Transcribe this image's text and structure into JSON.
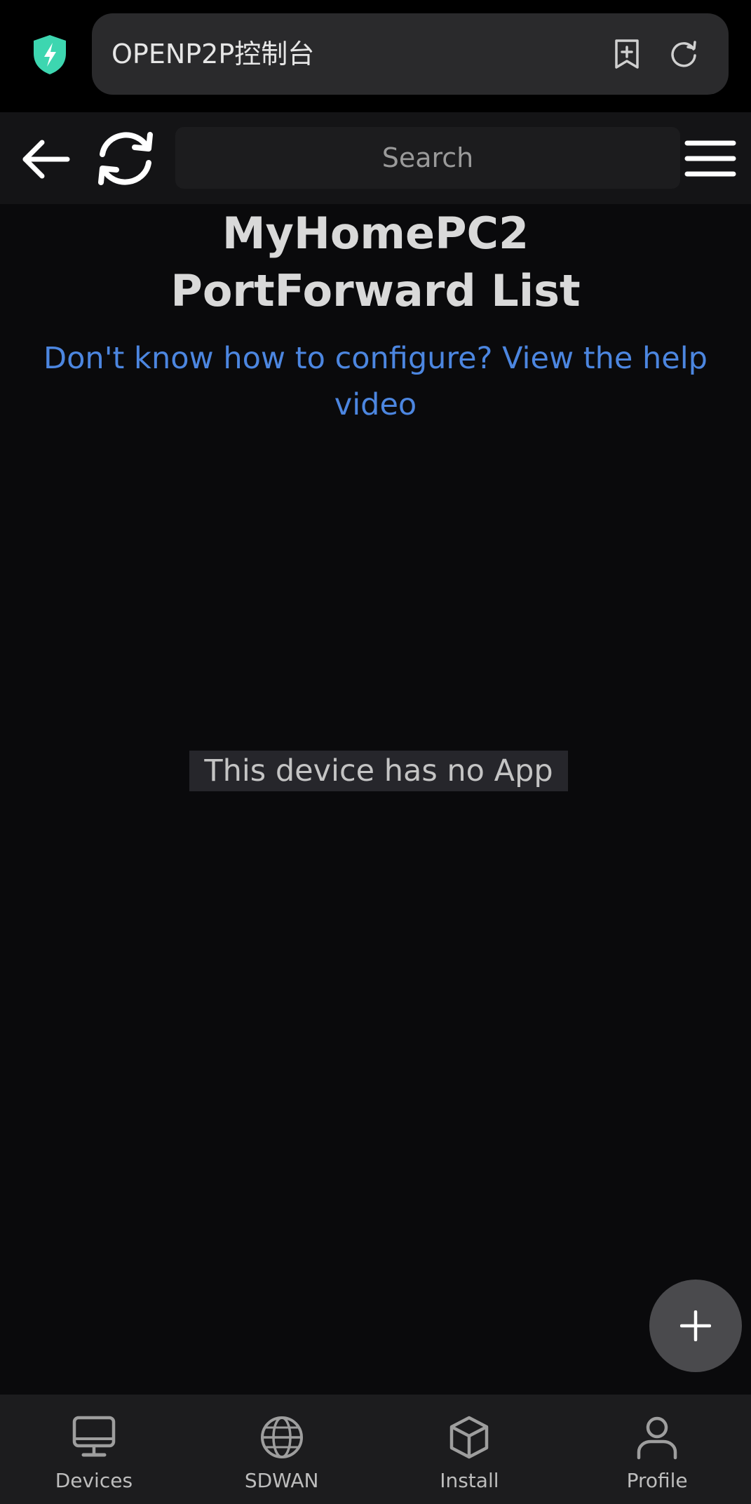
{
  "browser": {
    "url_title": "OPENP2P控制台",
    "accent": "#3dd6b0"
  },
  "header": {
    "search_placeholder": "Search"
  },
  "main": {
    "title_line1": "MyHomePC2",
    "title_line2": "PortForward List",
    "help_link": "Don't know how to configure? View the help video",
    "empty_message": "This device has no App",
    "link_color": "#4c86e0"
  },
  "fab": {
    "icon": "plus-icon"
  },
  "bottom_nav": {
    "items": [
      {
        "label": "Devices",
        "icon": "monitor-icon"
      },
      {
        "label": "SDWAN",
        "icon": "globe-icon"
      },
      {
        "label": "Install",
        "icon": "box-icon"
      },
      {
        "label": "Profile",
        "icon": "user-icon"
      }
    ]
  }
}
